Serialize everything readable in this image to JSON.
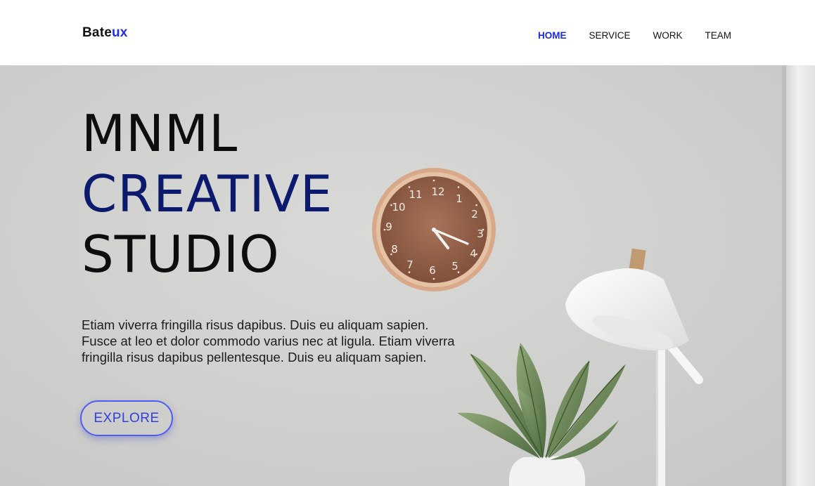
{
  "brand": {
    "name_main": "Bate",
    "name_accent": "ux"
  },
  "nav": [
    {
      "label": "HOME",
      "active": true
    },
    {
      "label": "SERVICE",
      "active": false
    },
    {
      "label": "WORK",
      "active": false
    },
    {
      "label": "TEAM",
      "active": false
    }
  ],
  "hero": {
    "line1": "MNML",
    "line2": "CREATIVE",
    "line3": "STUDIO",
    "paragraph": "Etiam viverra fringilla risus dapibus. Duis eu aliquam sapien. Fusce at leo et dolor commodo varius nec at ligula. Etiam viverra fringilla risus dapibus pellentesque. Duis eu aliquam sapien.",
    "cta_label": "EXPLORE"
  },
  "clock": {
    "numerals": [
      "12",
      "1",
      "2",
      "3",
      "4",
      "5",
      "6",
      "7",
      "8",
      "9",
      "10",
      "11"
    ]
  },
  "colors": {
    "accent": "#1f2fe0",
    "headline_blue": "#0c1a6e",
    "cta_border": "#4f5cf0"
  },
  "icons": {
    "clock": "wall-clock-image",
    "plant": "potted-plant-image",
    "lamp": "desk-lamp-image"
  }
}
